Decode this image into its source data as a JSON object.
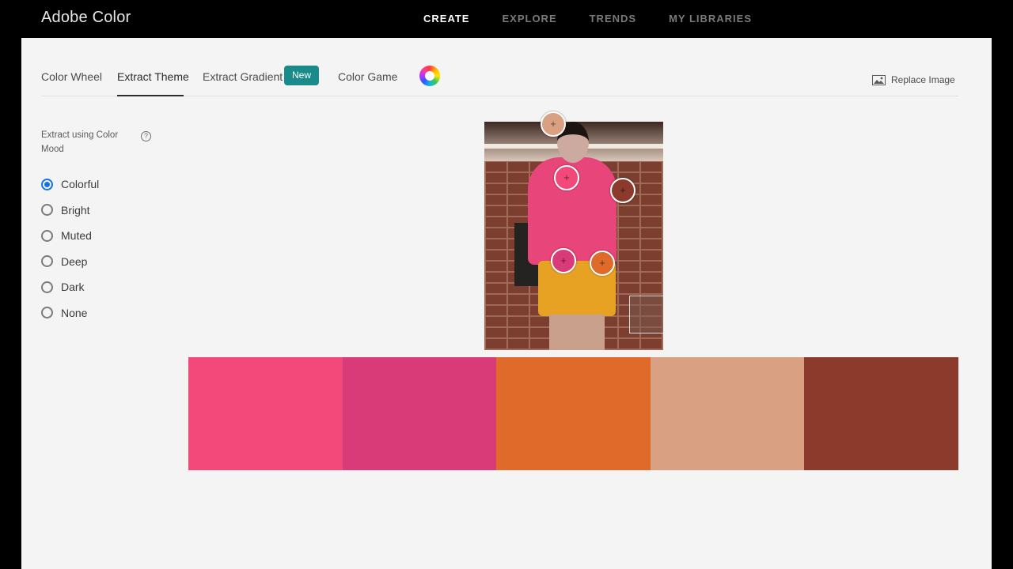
{
  "app": {
    "title": "Adobe Color"
  },
  "top_nav": [
    {
      "label": "CREATE",
      "active": true
    },
    {
      "label": "EXPLORE",
      "active": false
    },
    {
      "label": "TRENDS",
      "active": false
    },
    {
      "label": "MY LIBRARIES",
      "active": false
    }
  ],
  "sub_tabs": {
    "color_wheel": "Color Wheel",
    "extract_theme": "Extract Theme",
    "extract_gradient": "Extract Gradient",
    "new_badge": "New",
    "color_game": "Color Game",
    "active": "Extract Theme"
  },
  "replace_image": {
    "label": "Replace Image",
    "icon": "image-icon"
  },
  "mood": {
    "title": "Extract using Color Mood",
    "help_icon": "?",
    "options": [
      "Colorful",
      "Bright",
      "Muted",
      "Deep",
      "Dark",
      "None"
    ],
    "selected": "Colorful"
  },
  "pickers": [
    "+",
    "+",
    "+",
    "+",
    "+"
  ],
  "swatches": [
    "#f2497a",
    "#d93a78",
    "#e06a2a",
    "#d9a082",
    "#8c3a2b"
  ],
  "colors": {
    "accent": "#1473e6",
    "badge": "#1a8b8b",
    "topbar": "#000000",
    "panel": "#f4f4f4"
  }
}
